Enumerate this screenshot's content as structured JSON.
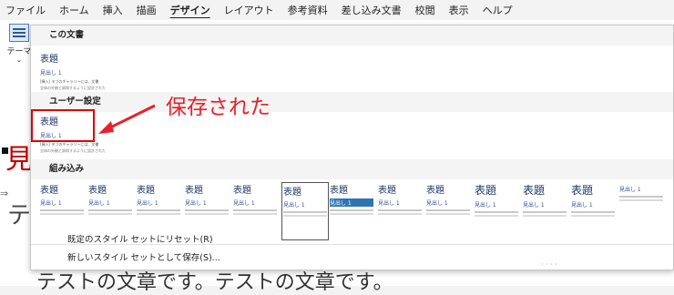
{
  "menu": {
    "items": [
      "ファイル",
      "ホーム",
      "挿入",
      "描画",
      "デザイン",
      "レイアウト",
      "参考資料",
      "差し込み文書",
      "校閲",
      "表示",
      "ヘルプ"
    ],
    "active": "デザイン"
  },
  "theme_button": {
    "label": "テーマ"
  },
  "gallery": {
    "sections": {
      "this_document": "この文書",
      "user_defined": "ユーザー設定",
      "builtin": "組み込み"
    },
    "this_document_thumb": {
      "title": "表題",
      "heading": "見出し 1",
      "body": "[挿入] タブのギャラリーには、文書",
      "body2": "全体の外観と調和するように設計された"
    },
    "user_thumb": {
      "title": "表題",
      "heading": "見出し 1",
      "body": "[挿入] タブのギャラリーには、文書",
      "body2": "全体の外観と調和するように設計された"
    },
    "builtin_thumbs": [
      {
        "title": "表題",
        "heading": "見出し 1"
      },
      {
        "title": "表題",
        "heading": "見出し 1"
      },
      {
        "title": "表題",
        "heading": "見出し 1"
      },
      {
        "title": "表題",
        "heading": "見出し 1"
      },
      {
        "title": "表題",
        "heading": "見出し 1"
      },
      {
        "title": "表題",
        "heading": "見出し 1"
      },
      {
        "title": "表題",
        "heading": "見出し 1"
      },
      {
        "title": "表題",
        "heading": "見出し 1"
      },
      {
        "title": "表題",
        "heading": "見出し 1"
      },
      {
        "title": "表題",
        "heading": "見出し 1"
      },
      {
        "title": "表題",
        "heading": "見出し 1"
      },
      {
        "title": "表題",
        "heading": "見出し 1"
      },
      {
        "title": "",
        "heading": "見出し 1"
      }
    ],
    "footer": {
      "reset": "既定のスタイル セットにリセット(R)",
      "save": "新しいスタイル セットとして保存(S)..."
    }
  },
  "annotation": {
    "text": "保存された",
    "color": "#e8212a"
  },
  "document": {
    "heading_char": "見",
    "line2_char": "テ",
    "body_text": "テストの文章です。テストの文章です。"
  }
}
